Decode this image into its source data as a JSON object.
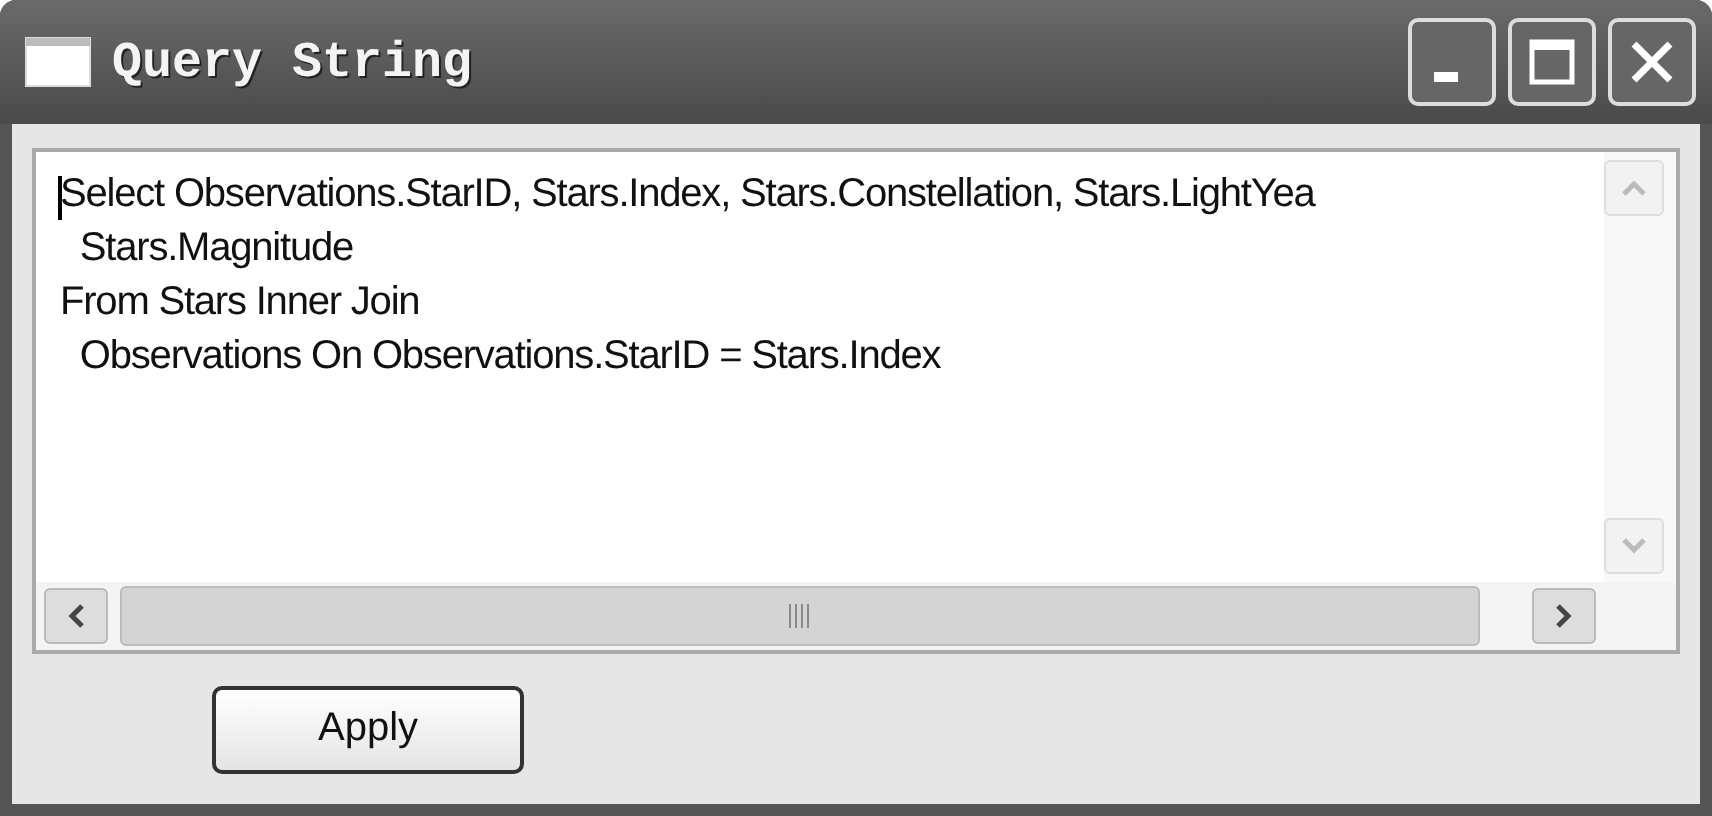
{
  "window": {
    "title": "Query String"
  },
  "query": {
    "lines": [
      "Select Observations.StarID, Stars.Index, Stars.Constellation, Stars.LightYea",
      "  Stars.Magnitude",
      "From Stars Inner Join",
      "  Observations On Observations.StarID = Stars.Index"
    ]
  },
  "buttons": [
    "Apply"
  ]
}
